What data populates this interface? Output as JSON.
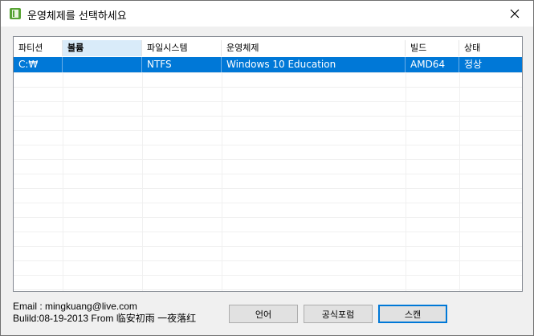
{
  "window": {
    "title": "운영체제를 선택하세요"
  },
  "table": {
    "columns": [
      "파티션",
      "볼륨",
      "파일시스템",
      "운영체제",
      "빌드",
      "상태"
    ],
    "rows": [
      [
        "C:₩",
        "",
        "NTFS",
        "Windows 10 Education",
        "AMD64",
        "정상"
      ]
    ]
  },
  "footer": {
    "email_line": "Email : mingkuang@live.com",
    "build_line": "Bulild:08-19-2013 From 临安初雨 一夜落红"
  },
  "buttons": {
    "language": "언어",
    "forum": "공식포럼",
    "scan": "스캔"
  },
  "colors": {
    "selection": "#0078d7",
    "sorted_header": "#d9ebf9",
    "app_icon": "#57a333"
  }
}
